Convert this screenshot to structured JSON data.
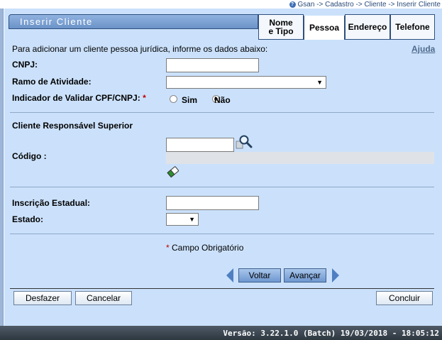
{
  "breadcrumb": "Gsan -> Cadastro -> Cliente -> Inserir Cliente",
  "header": {
    "title": "Inserir Cliente"
  },
  "tabs": [
    {
      "line1": "Nome",
      "line2": "e Tipo"
    },
    {
      "label": "Pessoa"
    },
    {
      "label": "Endereço"
    },
    {
      "label": "Telefone"
    }
  ],
  "intro_text": "Para adicionar um cliente pessoa jurídica, informe os dados abaixo:",
  "help_link": "Ajuda",
  "form": {
    "cnpj_label": "CNPJ:",
    "cnpj_value": "",
    "ramo_label": "Ramo de Atividade:",
    "ramo_value": "",
    "validar_label": "Indicador de Validar CPF/CNPJ:",
    "required_mark": "*",
    "sim_label": "Sim",
    "nao_label": "Não",
    "validar_selected": "Não"
  },
  "superior": {
    "section_title": "Cliente Responsável Superior",
    "codigo_label": "Código :",
    "codigo_value": ""
  },
  "inscricao": {
    "inscricao_label": "Inscrição Estadual:",
    "inscricao_value": "",
    "estado_label": "Estado:",
    "estado_value": ""
  },
  "required_note": "Campo Obrigatório",
  "nav": {
    "back_label": "Voltar",
    "next_label": "Avançar"
  },
  "actions": {
    "undo_label": "Desfazer",
    "cancel_label": "Cancelar",
    "finish_label": "Concluir"
  },
  "status": "Versão: 3.22.1.0 (Batch) 19/03/2018 - 18:05:12",
  "colors": {
    "panel": "#cbe1fb",
    "header": "#7ba0d4",
    "status_bar": "#3a444e",
    "required": "#c00000"
  },
  "icons": {
    "search": "magnifier-icon",
    "clear": "eraser-icon",
    "help": "help-circle-icon"
  }
}
